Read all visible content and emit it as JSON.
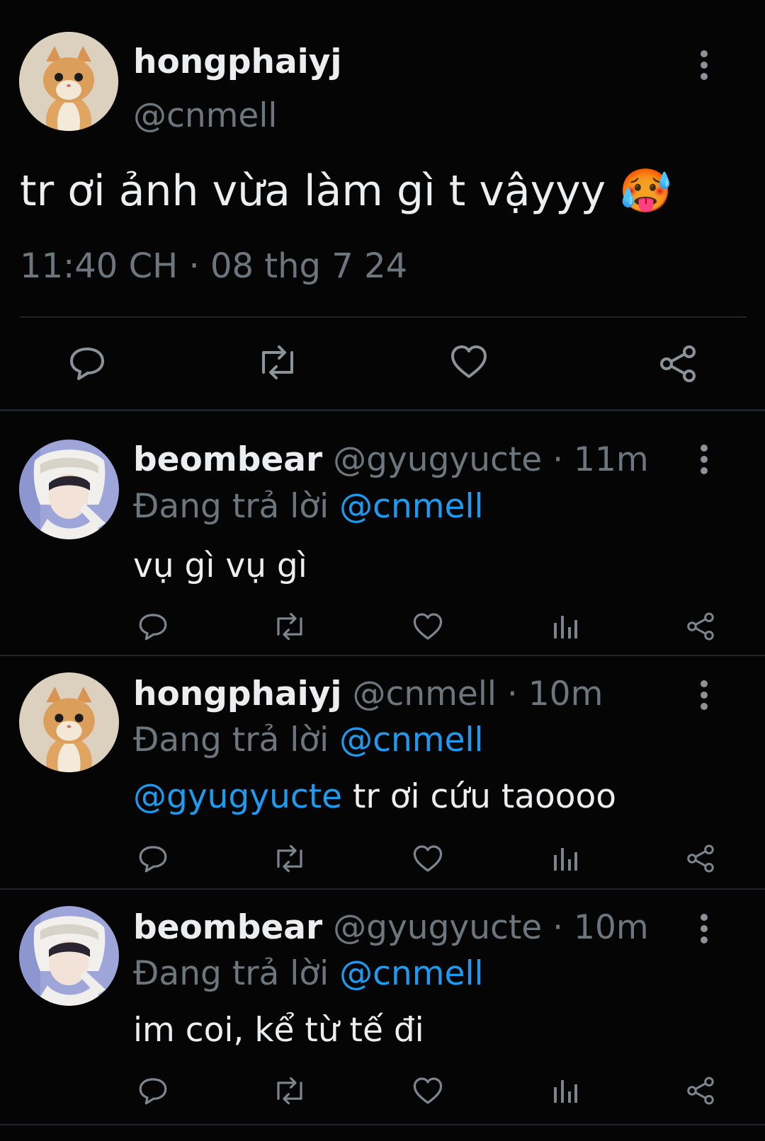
{
  "main_tweet": {
    "display_name": "hongphaiyj",
    "handle": "@cnmell",
    "text": "tr ơi ảnh vừa làm gì t vậyyy",
    "emoji": "🥵",
    "timestamp": "11:40 CH · 08 thg 7 24"
  },
  "replies": [
    {
      "display_name": "beombear",
      "handle": "@gyugyucte",
      "time": "· 11m",
      "replying_prefix": "Đang trả lời",
      "replying_to": "@cnmell",
      "mention": "",
      "text": "vụ gì vụ gì"
    },
    {
      "display_name": "hongphaiyj",
      "handle": "@cnmell",
      "time": "· 10m",
      "replying_prefix": "Đang trả lời",
      "replying_to": "@cnmell",
      "mention": "@gyugyucte",
      "text": " tr ơi cứu taoooo"
    },
    {
      "display_name": "beombear",
      "handle": "@gyugyucte",
      "time": "· 10m",
      "replying_prefix": "Đang trả lời",
      "replying_to": "@cnmell",
      "mention": "",
      "text": "im coi, kể từ tế đi"
    }
  ],
  "icons": {
    "reply": "reply-icon",
    "retweet": "retweet-icon",
    "like": "heart-icon",
    "views": "views-icon",
    "share": "share-icon",
    "more": "more-icon"
  },
  "colors": {
    "background": "#050506",
    "text": "#e7e9ea",
    "muted": "#6e767d",
    "link": "#1d9bf0"
  }
}
